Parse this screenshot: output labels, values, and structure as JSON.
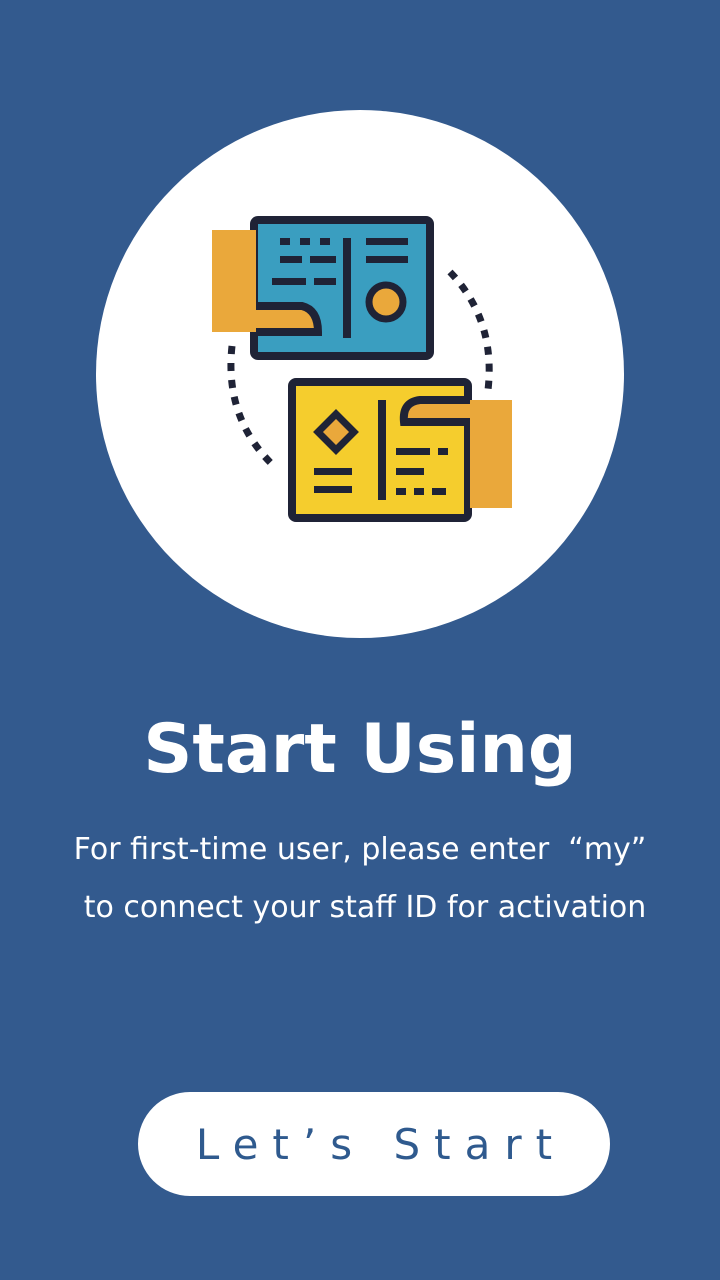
{
  "colors": {
    "background": "#335a8e",
    "circle": "#ffffff",
    "card_blue": "#3a9ec0",
    "card_yellow": "#f5cd2d",
    "hand": "#eaa83b",
    "outline": "#1f2336",
    "button_text": "#2f5a8e"
  },
  "hero": {
    "icon": "id-card-exchange-icon"
  },
  "content": {
    "title": "Start Using",
    "description_line1": "For first-time user, please enter  “my”",
    "description_line2": "to connect your staff ID for activation"
  },
  "actions": {
    "start_label": "Let’s Start"
  }
}
